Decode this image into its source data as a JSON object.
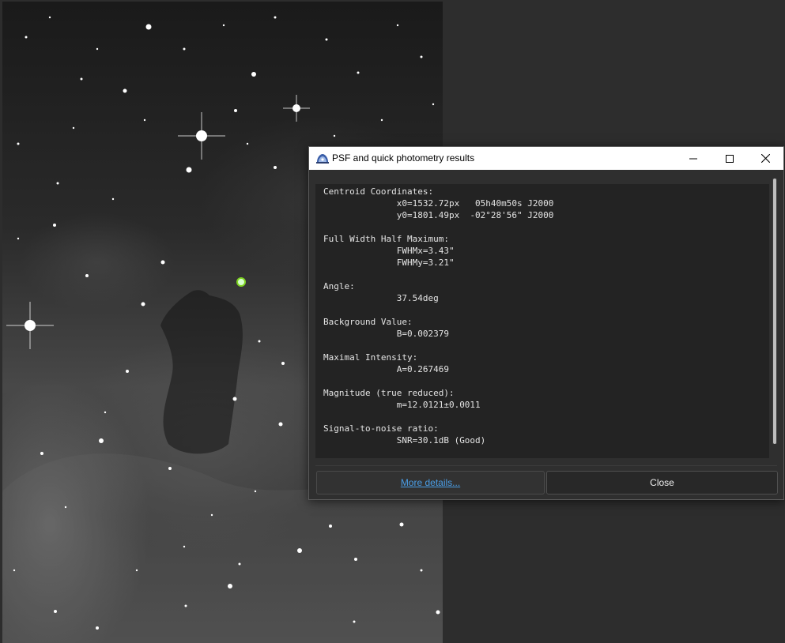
{
  "dialog": {
    "title": "PSF and quick photometry results",
    "app_icon": "siril-app-icon",
    "window_controls": {
      "minimize_icon": "minimize-icon",
      "maximize_icon": "maximize-icon",
      "close_icon": "close-icon"
    },
    "results_text": "Centroid Coordinates:\n\t\tx0=1532.72px\t 05h40m50s J2000\n\t\ty0=1801.49px\t-02°28'56\" J2000\n\nFull Width Half Maximum:\n\t\tFWHMx=3.43\"\n\t\tFWHMy=3.21\"\n\nAngle:\n\t\t37.54deg\n\nBackground Value:\n\t\tB=0.002379\n\nMaximal Intensity:\n\t\tA=0.267469\n\nMagnitude (true reduced):\n\t\tm=12.0121±0.0011\n\nSignal-to-noise ratio:\n\t\tSNR=30.1dB (Good)",
    "more_details_label": "More details...",
    "close_label": "Close"
  },
  "image": {
    "marker_color": "#7ed321"
  }
}
